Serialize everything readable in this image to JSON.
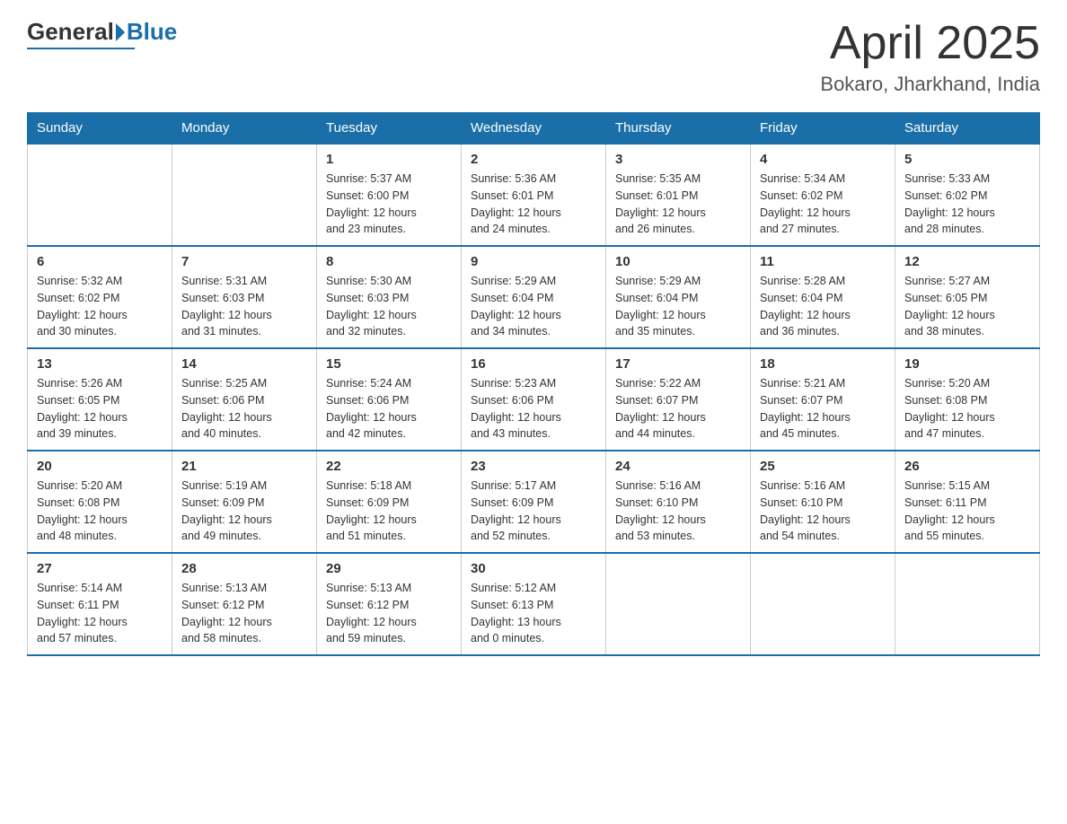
{
  "header": {
    "logo_general": "General",
    "logo_blue": "Blue",
    "title": "April 2025",
    "subtitle": "Bokaro, Jharkhand, India"
  },
  "weekdays": [
    "Sunday",
    "Monday",
    "Tuesday",
    "Wednesday",
    "Thursday",
    "Friday",
    "Saturday"
  ],
  "weeks": [
    [
      {
        "day": "",
        "info": ""
      },
      {
        "day": "",
        "info": ""
      },
      {
        "day": "1",
        "info": "Sunrise: 5:37 AM\nSunset: 6:00 PM\nDaylight: 12 hours\nand 23 minutes."
      },
      {
        "day": "2",
        "info": "Sunrise: 5:36 AM\nSunset: 6:01 PM\nDaylight: 12 hours\nand 24 minutes."
      },
      {
        "day": "3",
        "info": "Sunrise: 5:35 AM\nSunset: 6:01 PM\nDaylight: 12 hours\nand 26 minutes."
      },
      {
        "day": "4",
        "info": "Sunrise: 5:34 AM\nSunset: 6:02 PM\nDaylight: 12 hours\nand 27 minutes."
      },
      {
        "day": "5",
        "info": "Sunrise: 5:33 AM\nSunset: 6:02 PM\nDaylight: 12 hours\nand 28 minutes."
      }
    ],
    [
      {
        "day": "6",
        "info": "Sunrise: 5:32 AM\nSunset: 6:02 PM\nDaylight: 12 hours\nand 30 minutes."
      },
      {
        "day": "7",
        "info": "Sunrise: 5:31 AM\nSunset: 6:03 PM\nDaylight: 12 hours\nand 31 minutes."
      },
      {
        "day": "8",
        "info": "Sunrise: 5:30 AM\nSunset: 6:03 PM\nDaylight: 12 hours\nand 32 minutes."
      },
      {
        "day": "9",
        "info": "Sunrise: 5:29 AM\nSunset: 6:04 PM\nDaylight: 12 hours\nand 34 minutes."
      },
      {
        "day": "10",
        "info": "Sunrise: 5:29 AM\nSunset: 6:04 PM\nDaylight: 12 hours\nand 35 minutes."
      },
      {
        "day": "11",
        "info": "Sunrise: 5:28 AM\nSunset: 6:04 PM\nDaylight: 12 hours\nand 36 minutes."
      },
      {
        "day": "12",
        "info": "Sunrise: 5:27 AM\nSunset: 6:05 PM\nDaylight: 12 hours\nand 38 minutes."
      }
    ],
    [
      {
        "day": "13",
        "info": "Sunrise: 5:26 AM\nSunset: 6:05 PM\nDaylight: 12 hours\nand 39 minutes."
      },
      {
        "day": "14",
        "info": "Sunrise: 5:25 AM\nSunset: 6:06 PM\nDaylight: 12 hours\nand 40 minutes."
      },
      {
        "day": "15",
        "info": "Sunrise: 5:24 AM\nSunset: 6:06 PM\nDaylight: 12 hours\nand 42 minutes."
      },
      {
        "day": "16",
        "info": "Sunrise: 5:23 AM\nSunset: 6:06 PM\nDaylight: 12 hours\nand 43 minutes."
      },
      {
        "day": "17",
        "info": "Sunrise: 5:22 AM\nSunset: 6:07 PM\nDaylight: 12 hours\nand 44 minutes."
      },
      {
        "day": "18",
        "info": "Sunrise: 5:21 AM\nSunset: 6:07 PM\nDaylight: 12 hours\nand 45 minutes."
      },
      {
        "day": "19",
        "info": "Sunrise: 5:20 AM\nSunset: 6:08 PM\nDaylight: 12 hours\nand 47 minutes."
      }
    ],
    [
      {
        "day": "20",
        "info": "Sunrise: 5:20 AM\nSunset: 6:08 PM\nDaylight: 12 hours\nand 48 minutes."
      },
      {
        "day": "21",
        "info": "Sunrise: 5:19 AM\nSunset: 6:09 PM\nDaylight: 12 hours\nand 49 minutes."
      },
      {
        "day": "22",
        "info": "Sunrise: 5:18 AM\nSunset: 6:09 PM\nDaylight: 12 hours\nand 51 minutes."
      },
      {
        "day": "23",
        "info": "Sunrise: 5:17 AM\nSunset: 6:09 PM\nDaylight: 12 hours\nand 52 minutes."
      },
      {
        "day": "24",
        "info": "Sunrise: 5:16 AM\nSunset: 6:10 PM\nDaylight: 12 hours\nand 53 minutes."
      },
      {
        "day": "25",
        "info": "Sunrise: 5:16 AM\nSunset: 6:10 PM\nDaylight: 12 hours\nand 54 minutes."
      },
      {
        "day": "26",
        "info": "Sunrise: 5:15 AM\nSunset: 6:11 PM\nDaylight: 12 hours\nand 55 minutes."
      }
    ],
    [
      {
        "day": "27",
        "info": "Sunrise: 5:14 AM\nSunset: 6:11 PM\nDaylight: 12 hours\nand 57 minutes."
      },
      {
        "day": "28",
        "info": "Sunrise: 5:13 AM\nSunset: 6:12 PM\nDaylight: 12 hours\nand 58 minutes."
      },
      {
        "day": "29",
        "info": "Sunrise: 5:13 AM\nSunset: 6:12 PM\nDaylight: 12 hours\nand 59 minutes."
      },
      {
        "day": "30",
        "info": "Sunrise: 5:12 AM\nSunset: 6:13 PM\nDaylight: 13 hours\nand 0 minutes."
      },
      {
        "day": "",
        "info": ""
      },
      {
        "day": "",
        "info": ""
      },
      {
        "day": "",
        "info": ""
      }
    ]
  ]
}
